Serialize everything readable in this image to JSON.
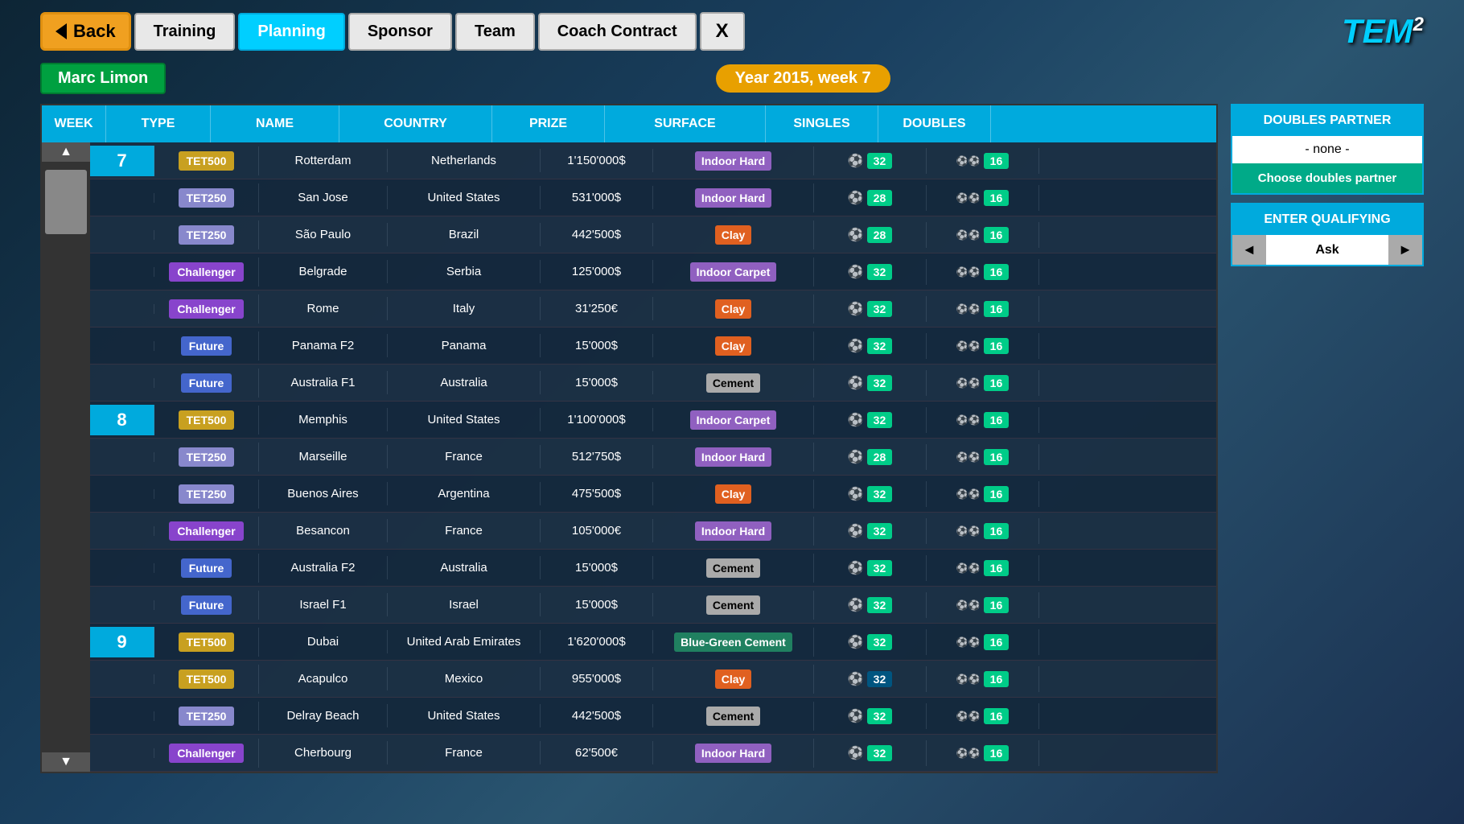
{
  "nav": {
    "back": "Back",
    "training": "Training",
    "planning": "Planning",
    "sponsor": "Sponsor",
    "team": "Team",
    "coach_contract": "Coach Contract",
    "close": "X"
  },
  "logo": {
    "text": "TEM",
    "sup": "2"
  },
  "player": {
    "name": "Marc Limon"
  },
  "year_week": "Year 2015, week 7",
  "table": {
    "headers": [
      "WEEK",
      "TYPE",
      "NAME",
      "COUNTRY",
      "PRIZE",
      "SURFACE",
      "SINGLES",
      "DOUBLES"
    ],
    "rows": [
      {
        "week": "7",
        "type": "TET500",
        "name": "Rotterdam",
        "country": "Netherlands",
        "prize": "1'150'000$",
        "surface": "Indoor Hard",
        "surface_type": "indoor-hard",
        "singles": "32",
        "doubles": "16"
      },
      {
        "week": "",
        "type": "TET250",
        "name": "San Jose",
        "country": "United States",
        "prize": "531'000$",
        "surface": "Indoor Hard",
        "surface_type": "indoor-hard",
        "singles": "28",
        "doubles": "16"
      },
      {
        "week": "",
        "type": "TET250",
        "name": "São Paulo",
        "country": "Brazil",
        "prize": "442'500$",
        "surface": "Clay",
        "surface_type": "clay",
        "singles": "28",
        "doubles": "16"
      },
      {
        "week": "",
        "type": "Challenger",
        "name": "Belgrade",
        "country": "Serbia",
        "prize": "125'000$",
        "surface": "Indoor Carpet",
        "surface_type": "indoor-carpet",
        "singles": "32",
        "doubles": "16"
      },
      {
        "week": "",
        "type": "Challenger",
        "name": "Rome",
        "country": "Italy",
        "prize": "31'250€",
        "surface": "Clay",
        "surface_type": "clay",
        "singles": "32",
        "doubles": "16"
      },
      {
        "week": "",
        "type": "Future",
        "name": "Panama F2",
        "country": "Panama",
        "prize": "15'000$",
        "surface": "Clay",
        "surface_type": "clay",
        "singles": "32",
        "doubles": "16"
      },
      {
        "week": "",
        "type": "Future",
        "name": "Australia F1",
        "country": "Australia",
        "prize": "15'000$",
        "surface": "Cement",
        "surface_type": "cement",
        "singles": "32",
        "doubles": "16"
      },
      {
        "week": "8",
        "type": "TET500",
        "name": "Memphis",
        "country": "United States",
        "prize": "1'100'000$",
        "surface": "Indoor Carpet",
        "surface_type": "indoor-carpet",
        "singles": "32",
        "doubles": "16"
      },
      {
        "week": "",
        "type": "TET250",
        "name": "Marseille",
        "country": "France",
        "prize": "512'750$",
        "surface": "Indoor Hard",
        "surface_type": "indoor-hard",
        "singles": "28",
        "doubles": "16"
      },
      {
        "week": "",
        "type": "TET250",
        "name": "Buenos Aires",
        "country": "Argentina",
        "prize": "475'500$",
        "surface": "Clay",
        "surface_type": "clay",
        "singles": "32",
        "doubles": "16"
      },
      {
        "week": "",
        "type": "Challenger",
        "name": "Besancon",
        "country": "France",
        "prize": "105'000€",
        "surface": "Indoor Hard",
        "surface_type": "indoor-hard",
        "singles": "32",
        "doubles": "16"
      },
      {
        "week": "",
        "type": "Future",
        "name": "Australia F2",
        "country": "Australia",
        "prize": "15'000$",
        "surface": "Cement",
        "surface_type": "cement",
        "singles": "32",
        "doubles": "16"
      },
      {
        "week": "",
        "type": "Future",
        "name": "Israel F1",
        "country": "Israel",
        "prize": "15'000$",
        "surface": "Cement",
        "surface_type": "cement",
        "singles": "32",
        "doubles": "16"
      },
      {
        "week": "9",
        "type": "TET500",
        "name": "Dubai",
        "country": "United Arab Emirates",
        "prize": "1'620'000$",
        "surface": "Blue-Green Cement",
        "surface_type": "blue-green",
        "singles": "32",
        "doubles": "16"
      },
      {
        "week": "",
        "type": "TET500",
        "name": "Acapulco",
        "country": "Mexico",
        "prize": "955'000$",
        "surface": "Clay",
        "surface_type": "clay",
        "singles": "32",
        "doubles": "16",
        "singles_active": true
      },
      {
        "week": "",
        "type": "TET250",
        "name": "Delray Beach",
        "country": "United States",
        "prize": "442'500$",
        "surface": "Cement",
        "surface_type": "cement",
        "singles": "32",
        "doubles": "16"
      },
      {
        "week": "",
        "type": "Challenger",
        "name": "Cherbourg",
        "country": "France",
        "prize": "62'500€",
        "surface": "Indoor Hard",
        "surface_type": "indoor-hard",
        "singles": "32",
        "doubles": "16"
      }
    ]
  },
  "side_panel": {
    "doubles_partner_label": "DOUBLES PARTNER",
    "doubles_partner_value": "- none -",
    "choose_btn": "Choose doubles partner",
    "enter_qualifying_label": "ENTER QUALIFYING",
    "ask_label": "Ask",
    "left_arrow": "◄",
    "right_arrow": "►"
  }
}
